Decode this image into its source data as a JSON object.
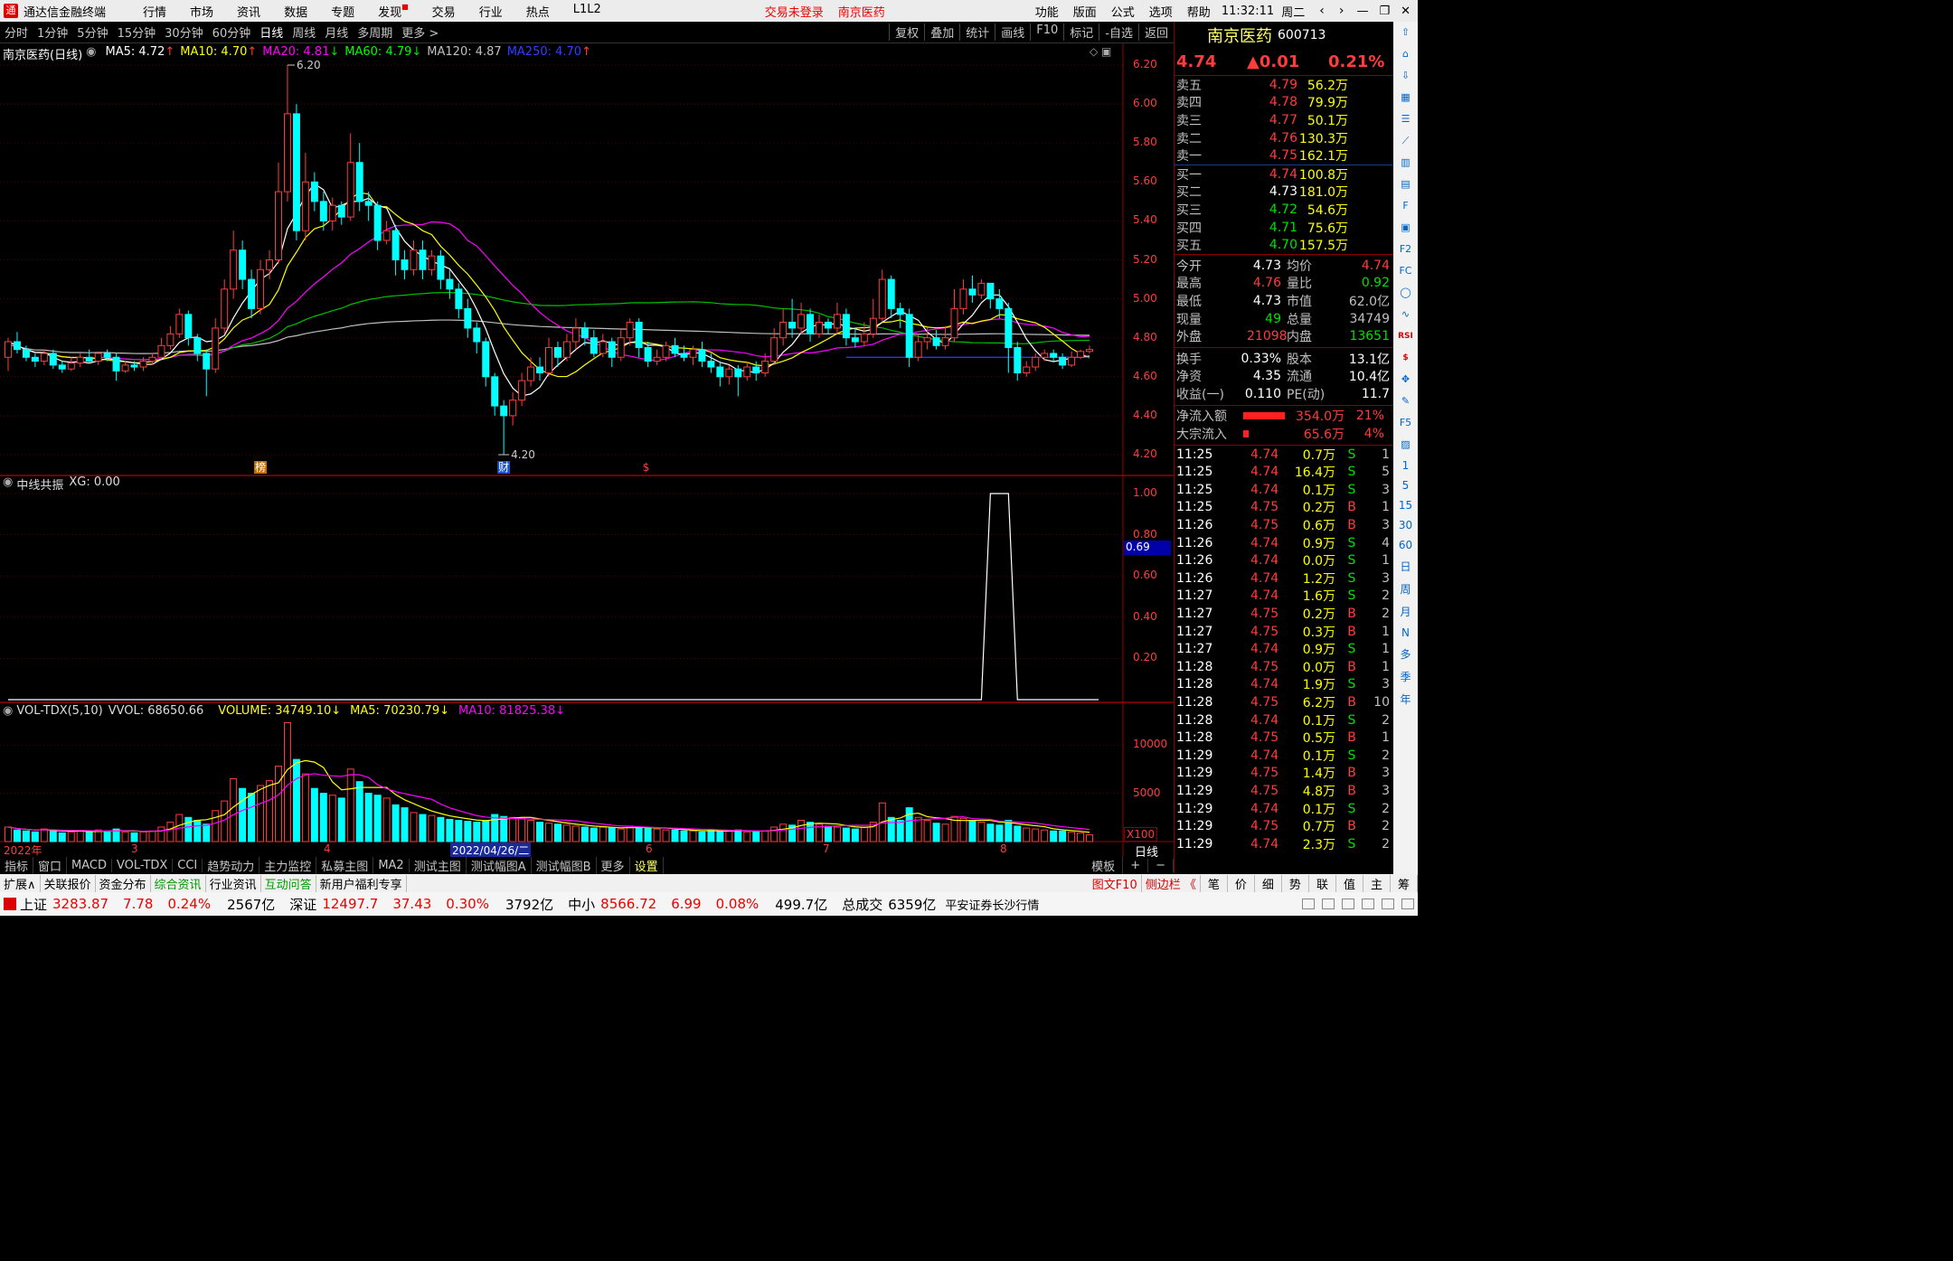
{
  "app": {
    "title": "通达信金融终端",
    "time": "11:32:11",
    "weekday": "周二"
  },
  "menu": [
    "行情",
    "市场",
    "资讯",
    "数据",
    "专题",
    "发现",
    "交易",
    "行业",
    "热点",
    "L1L2"
  ],
  "menu_right": [
    "功能",
    "版面",
    "公式",
    "选项",
    "帮助"
  ],
  "login_status": "交易未登录",
  "top_stock": "南京医药",
  "toolbar": {
    "periods": [
      "分时",
      "1分钟",
      "5分钟",
      "15分钟",
      "30分钟",
      "60分钟",
      "日线",
      "周线",
      "月线",
      "多周期",
      "更多 >"
    ],
    "active": "日线",
    "right": [
      "复权",
      "叠加",
      "统计",
      "画线",
      "F10",
      "标记",
      "-自选",
      "返回"
    ]
  },
  "chart": {
    "title": "南京医药(日线)",
    "ma_legend": [
      {
        "label": "MA5: 4.72",
        "arrow": "↑",
        "color": "#ffffff"
      },
      {
        "label": "MA10: 4.70",
        "arrow": "↑",
        "color": "#ffff00"
      },
      {
        "label": "MA20: 4.81",
        "arrow": "↓",
        "color": "#ff00ff"
      },
      {
        "label": "MA60: 4.79",
        "arrow": "↓",
        "color": "#00ff00"
      },
      {
        "label": "MA120: 4.87",
        "arrow": "",
        "color": "#c0c0c0"
      },
      {
        "label": "MA250: 4.70",
        "arrow": "↑",
        "color": "#3040ff"
      }
    ],
    "price_axis": [
      "6.20",
      "6.00",
      "5.80",
      "5.60",
      "5.40",
      "5.20",
      "5.00",
      "4.80",
      "4.60",
      "4.40",
      "4.20"
    ],
    "high_label": "6.20",
    "low_label": "4.20",
    "markers": [
      "榜",
      "财",
      "$"
    ]
  },
  "indicator": {
    "title": "中线共振",
    "xg": "XG: 0.00",
    "axis": [
      "1.00",
      "0.80",
      "0.60",
      "0.40",
      "0.20"
    ],
    "current": "0.69"
  },
  "volume": {
    "title": "VOL-TDX(5,10)",
    "vvol": "VVOL: 68650.66",
    "vol": "VOLUME: 34749.10",
    "ma5": "MA5: 70230.79",
    "ma10": "MA10: 81825.38",
    "axis": [
      "10000",
      "5000"
    ],
    "unit": "X100"
  },
  "date_axis": {
    "labels": [
      "2022年",
      "3",
      "4",
      "2022/04/26/二",
      "6",
      "7",
      "8"
    ],
    "period": "日线"
  },
  "quote": {
    "name": "南京医药",
    "code": "600713",
    "price": "4.74",
    "change": "▲0.01",
    "pct": "0.21%",
    "asks": [
      {
        "l": "卖五",
        "p": "4.79",
        "v": "56.2万"
      },
      {
        "l": "卖四",
        "p": "4.78",
        "v": "79.9万"
      },
      {
        "l": "卖三",
        "p": "4.77",
        "v": "50.1万"
      },
      {
        "l": "卖二",
        "p": "4.76",
        "v": "130.3万"
      },
      {
        "l": "卖一",
        "p": "4.75",
        "v": "162.1万"
      }
    ],
    "bids": [
      {
        "l": "买一",
        "p": "4.74",
        "v": "100.8万",
        "c": "red"
      },
      {
        "l": "买二",
        "p": "4.73",
        "v": "181.0万",
        "c": "wht"
      },
      {
        "l": "买三",
        "p": "4.72",
        "v": "54.6万",
        "c": "grn"
      },
      {
        "l": "买四",
        "p": "4.71",
        "v": "75.6万",
        "c": "grn"
      },
      {
        "l": "买五",
        "p": "4.70",
        "v": "157.5万",
        "c": "grn"
      }
    ],
    "stats": [
      {
        "l1": "今开",
        "v1": "4.73",
        "c1": "wht",
        "l2": "均价",
        "v2": "4.74",
        "c2": "red"
      },
      {
        "l1": "最高",
        "v1": "4.76",
        "c1": "red",
        "l2": "量比",
        "v2": "0.92",
        "c2": "grn"
      },
      {
        "l1": "最低",
        "v1": "4.73",
        "c1": "wht",
        "l2": "市值",
        "v2": "62.0亿",
        "c2": "gray"
      },
      {
        "l1": "现量",
        "v1": "49",
        "c1": "grn",
        "l2": "总量",
        "v2": "34749",
        "c2": "gray"
      },
      {
        "l1": "外盘",
        "v1": "21098",
        "c1": "red",
        "l2": "内盘",
        "v2": "13651",
        "c2": "grn"
      }
    ],
    "stats2": [
      {
        "l1": "换手",
        "v1": "0.33%",
        "l2": "股本",
        "v2": "13.1亿"
      },
      {
        "l1": "净资",
        "v1": "4.35",
        "l2": "流通",
        "v2": "10.4亿"
      },
      {
        "l1": "收益(一)",
        "v1": "0.110",
        "l2": "PE(动)",
        "v2": "11.7"
      }
    ],
    "flows": [
      {
        "l": "净流入额",
        "v": "354.0万",
        "p": "21%",
        "bar": 0.8
      },
      {
        "l": "大宗流入",
        "v": "65.6万",
        "p": "4%",
        "bar": 0.1
      }
    ],
    "ticks": [
      [
        "11:25",
        "4.74",
        "0.7万",
        "S",
        "1"
      ],
      [
        "11:25",
        "4.74",
        "16.4万",
        "S",
        "5"
      ],
      [
        "11:25",
        "4.74",
        "0.1万",
        "S",
        "3"
      ],
      [
        "11:25",
        "4.75",
        "0.2万",
        "B",
        "1"
      ],
      [
        "11:26",
        "4.75",
        "0.6万",
        "B",
        "3"
      ],
      [
        "11:26",
        "4.74",
        "0.9万",
        "S",
        "4"
      ],
      [
        "11:26",
        "4.74",
        "0.0万",
        "S",
        "1"
      ],
      [
        "11:26",
        "4.74",
        "1.2万",
        "S",
        "3"
      ],
      [
        "11:27",
        "4.74",
        "1.6万",
        "S",
        "2"
      ],
      [
        "11:27",
        "4.75",
        "0.2万",
        "B",
        "2"
      ],
      [
        "11:27",
        "4.75",
        "0.3万",
        "B",
        "1"
      ],
      [
        "11:27",
        "4.74",
        "0.9万",
        "S",
        "1"
      ],
      [
        "11:28",
        "4.75",
        "0.0万",
        "B",
        "1"
      ],
      [
        "11:28",
        "4.74",
        "1.9万",
        "S",
        "3"
      ],
      [
        "11:28",
        "4.75",
        "6.2万",
        "B",
        "10"
      ],
      [
        "11:28",
        "4.74",
        "0.1万",
        "S",
        "2"
      ],
      [
        "11:28",
        "4.75",
        "0.5万",
        "B",
        "1"
      ],
      [
        "11:29",
        "4.74",
        "0.1万",
        "S",
        "2"
      ],
      [
        "11:29",
        "4.75",
        "1.4万",
        "B",
        "3"
      ],
      [
        "11:29",
        "4.75",
        "4.8万",
        "B",
        "3"
      ],
      [
        "11:29",
        "4.74",
        "0.1万",
        "S",
        "2"
      ],
      [
        "11:29",
        "4.75",
        "0.7万",
        "B",
        "2"
      ],
      [
        "11:29",
        "4.74",
        "2.3万",
        "S",
        "2"
      ]
    ]
  },
  "sidebar_icons": [
    "up-icon",
    "home-icon",
    "down-icon",
    "chart-icon",
    "list-icon",
    "trend-icon",
    "candle-icon",
    "doc-icon",
    "f10-icon",
    "book-icon",
    "f2-icon",
    "fc-icon",
    "circle-icon",
    "line-icon",
    "rsi",
    "dollar-icon",
    "move-icon",
    "pen-icon",
    "f5-icon",
    "sheet-icon"
  ],
  "sidebar_periods": [
    "1",
    "5",
    "15",
    "30",
    "60",
    "日",
    "周",
    "月",
    "N",
    "多",
    "季",
    "年"
  ],
  "tabs": [
    "指标",
    "窗口",
    "MACD",
    "VOL-TDX",
    "CCI",
    "趋势动力",
    "主力监控",
    "私募主图",
    "MA2",
    "测试主图",
    "测试幅图A",
    "测试幅图B",
    "更多",
    "设置"
  ],
  "tabs_right": [
    "模板",
    "+",
    "−"
  ],
  "bottom_tabs": [
    "扩展∧",
    "关联报价",
    "资金分布",
    "综合资讯",
    "行业资讯",
    "互动问答",
    "新用户福利专享"
  ],
  "bottom_right": [
    "图文F10",
    "侧边栏 《",
    "笔",
    "价",
    "细",
    "势",
    "联",
    "值",
    "主",
    "筹"
  ],
  "status": {
    "indices": [
      {
        "n": "上证",
        "v": "3283.87",
        "c": "7.78",
        "p": "0.24%",
        "a": "2567亿"
      },
      {
        "n": "深证",
        "v": "12497.7",
        "c": "37.43",
        "p": "0.30%",
        "a": "3792亿"
      },
      {
        "n": "中小",
        "v": "8566.72",
        "c": "6.99",
        "p": "0.08%",
        "a": "499.7亿"
      }
    ],
    "total_label": "总成交",
    "total": "6359亿",
    "broker": "平安证券长沙行情"
  },
  "chart_data": {
    "type": "candlestick",
    "ylim": [
      4.2,
      6.2
    ],
    "candles": [
      [
        4.7,
        4.78,
        4.63,
        4.8
      ],
      [
        4.78,
        4.74,
        4.72,
        4.83
      ],
      [
        4.74,
        4.7,
        4.68,
        4.76
      ],
      [
        4.7,
        4.68,
        4.65,
        4.72
      ],
      [
        4.68,
        4.72,
        4.66,
        4.74
      ],
      [
        4.72,
        4.66,
        4.64,
        4.74
      ],
      [
        4.66,
        4.64,
        4.62,
        4.68
      ],
      [
        4.64,
        4.67,
        4.63,
        4.7
      ],
      [
        4.67,
        4.7,
        4.65,
        4.72
      ],
      [
        4.7,
        4.68,
        4.67,
        4.74
      ],
      [
        4.68,
        4.72,
        4.66,
        4.73
      ],
      [
        4.72,
        4.7,
        4.68,
        4.74
      ],
      [
        4.7,
        4.63,
        4.58,
        4.72
      ],
      [
        4.63,
        4.66,
        4.62,
        4.68
      ],
      [
        4.66,
        4.65,
        4.63,
        4.68
      ],
      [
        4.65,
        4.68,
        4.63,
        4.7
      ],
      [
        4.68,
        4.7,
        4.66,
        4.72
      ],
      [
        4.7,
        4.76,
        4.69,
        4.8
      ],
      [
        4.76,
        4.82,
        4.74,
        4.86
      ],
      [
        4.82,
        4.92,
        4.8,
        4.95
      ],
      [
        4.92,
        4.8,
        4.76,
        4.94
      ],
      [
        4.8,
        4.72,
        4.68,
        4.82
      ],
      [
        4.72,
        4.64,
        4.5,
        4.74
      ],
      [
        4.64,
        4.85,
        4.62,
        4.9
      ],
      [
        4.85,
        5.05,
        4.82,
        5.1
      ],
      [
        5.05,
        5.25,
        5.0,
        5.35
      ],
      [
        5.25,
        5.1,
        5.05,
        5.3
      ],
      [
        5.1,
        4.95,
        4.9,
        5.15
      ],
      [
        4.95,
        5.15,
        4.92,
        5.2
      ],
      [
        5.15,
        5.2,
        5.1,
        5.25
      ],
      [
        5.2,
        5.55,
        5.18,
        5.7
      ],
      [
        5.55,
        5.95,
        5.5,
        6.2
      ],
      [
        5.95,
        5.35,
        5.3,
        6.0
      ],
      [
        5.35,
        5.6,
        5.3,
        5.75
      ],
      [
        5.6,
        5.5,
        5.45,
        5.65
      ],
      [
        5.5,
        5.4,
        5.35,
        5.55
      ],
      [
        5.4,
        5.48,
        5.35,
        5.52
      ],
      [
        5.48,
        5.42,
        5.38,
        5.5
      ],
      [
        5.42,
        5.7,
        5.4,
        5.85
      ],
      [
        5.7,
        5.5,
        5.45,
        5.8
      ],
      [
        5.5,
        5.48,
        5.4,
        5.55
      ],
      [
        5.48,
        5.3,
        5.25,
        5.5
      ],
      [
        5.3,
        5.35,
        5.28,
        5.4
      ],
      [
        5.35,
        5.2,
        5.12,
        5.38
      ],
      [
        5.2,
        5.15,
        5.1,
        5.25
      ],
      [
        5.15,
        5.25,
        5.12,
        5.3
      ],
      [
        5.25,
        5.15,
        5.1,
        5.3
      ],
      [
        5.15,
        5.22,
        5.12,
        5.25
      ],
      [
        5.22,
        5.1,
        5.05,
        5.25
      ],
      [
        5.1,
        5.05,
        5.0,
        5.15
      ],
      [
        5.05,
        4.95,
        4.9,
        5.08
      ],
      [
        4.95,
        4.85,
        4.8,
        5.0
      ],
      [
        4.85,
        4.78,
        4.72,
        4.88
      ],
      [
        4.78,
        4.6,
        4.55,
        4.8
      ],
      [
        4.6,
        4.45,
        4.4,
        4.62
      ],
      [
        4.45,
        4.4,
        4.2,
        4.48
      ],
      [
        4.4,
        4.48,
        4.35,
        4.52
      ],
      [
        4.48,
        4.58,
        4.45,
        4.62
      ],
      [
        4.58,
        4.65,
        4.55,
        4.7
      ],
      [
        4.65,
        4.62,
        4.58,
        4.7
      ],
      [
        4.62,
        4.75,
        4.6,
        4.8
      ],
      [
        4.75,
        4.7,
        4.65,
        4.78
      ],
      [
        4.7,
        4.78,
        4.68,
        4.82
      ],
      [
        4.78,
        4.85,
        4.74,
        4.9
      ],
      [
        4.85,
        4.8,
        4.76,
        4.88
      ],
      [
        4.8,
        4.72,
        4.7,
        4.84
      ],
      [
        4.72,
        4.78,
        4.7,
        4.82
      ],
      [
        4.78,
        4.7,
        4.65,
        4.8
      ],
      [
        4.7,
        4.8,
        4.68,
        4.85
      ],
      [
        4.8,
        4.88,
        4.76,
        4.9
      ],
      [
        4.88,
        4.75,
        4.7,
        4.9
      ],
      [
        4.75,
        4.68,
        4.65,
        4.78
      ],
      [
        4.68,
        4.7,
        4.66,
        4.74
      ],
      [
        4.7,
        4.76,
        4.68,
        4.78
      ],
      [
        4.76,
        4.72,
        4.7,
        4.8
      ],
      [
        4.72,
        4.7,
        4.68,
        4.76
      ],
      [
        4.7,
        4.74,
        4.66,
        4.76
      ],
      [
        4.74,
        4.68,
        4.65,
        4.78
      ],
      [
        4.68,
        4.65,
        4.62,
        4.72
      ],
      [
        4.65,
        4.6,
        4.55,
        4.68
      ],
      [
        4.6,
        4.64,
        4.56,
        4.66
      ],
      [
        4.64,
        4.6,
        4.5,
        4.66
      ],
      [
        4.6,
        4.65,
        4.58,
        4.68
      ],
      [
        4.65,
        4.62,
        4.58,
        4.68
      ],
      [
        4.62,
        4.68,
        4.6,
        4.72
      ],
      [
        4.68,
        4.8,
        4.66,
        4.85
      ],
      [
        4.8,
        4.88,
        4.76,
        4.95
      ],
      [
        4.88,
        4.85,
        4.8,
        5.0
      ],
      [
        4.85,
        4.92,
        4.82,
        4.98
      ],
      [
        4.92,
        4.82,
        4.78,
        4.95
      ],
      [
        4.82,
        4.88,
        4.8,
        4.92
      ],
      [
        4.88,
        4.85,
        4.82,
        4.9
      ],
      [
        4.85,
        4.92,
        4.82,
        4.98
      ],
      [
        4.92,
        4.8,
        4.76,
        4.95
      ],
      [
        4.8,
        4.78,
        4.75,
        4.85
      ],
      [
        4.78,
        4.82,
        4.76,
        4.88
      ],
      [
        4.82,
        4.9,
        4.8,
        5.0
      ],
      [
        4.9,
        5.1,
        4.88,
        5.15
      ],
      [
        5.1,
        4.95,
        4.9,
        5.12
      ],
      [
        4.95,
        4.92,
        4.85,
        4.98
      ],
      [
        4.92,
        4.7,
        4.65,
        4.95
      ],
      [
        4.7,
        4.78,
        4.68,
        4.82
      ],
      [
        4.78,
        4.8,
        4.74,
        4.85
      ],
      [
        4.8,
        4.76,
        4.74,
        4.84
      ],
      [
        4.76,
        4.8,
        4.74,
        4.86
      ],
      [
        4.8,
        4.95,
        4.78,
        5.05
      ],
      [
        4.95,
        5.05,
        4.92,
        5.1
      ],
      [
        5.05,
        5.02,
        4.98,
        5.12
      ],
      [
        5.02,
        5.08,
        5.0,
        5.1
      ],
      [
        5.08,
        5.0,
        4.95,
        5.08
      ],
      [
        5.0,
        4.95,
        4.9,
        5.05
      ],
      [
        4.95,
        4.75,
        4.62,
        4.98
      ],
      [
        4.75,
        4.62,
        4.58,
        4.78
      ],
      [
        4.62,
        4.65,
        4.6,
        4.68
      ],
      [
        4.65,
        4.7,
        4.63,
        4.72
      ],
      [
        4.7,
        4.72,
        4.68,
        4.74
      ],
      [
        4.72,
        4.7,
        4.68,
        4.74
      ],
      [
        4.7,
        4.66,
        4.64,
        4.72
      ],
      [
        4.66,
        4.7,
        4.65,
        4.73
      ],
      [
        4.7,
        4.73,
        4.69,
        4.74
      ],
      [
        4.73,
        4.74,
        4.72,
        4.76
      ]
    ],
    "volumes": [
      1500,
      1200,
      1100,
      1000,
      1300,
      1200,
      900,
      1000,
      1100,
      1000,
      1200,
      1100,
      1300,
      1000,
      900,
      1000,
      1100,
      1500,
      2000,
      2800,
      2500,
      2200,
      1800,
      3200,
      4200,
      6500,
      5500,
      5000,
      5800,
      6300,
      7800,
      12300,
      8500,
      7000,
      5500,
      5000,
      4800,
      4500,
      7500,
      6200,
      5000,
      4800,
      4500,
      3800,
      3500,
      3000,
      2800,
      2700,
      2500,
      2300,
      2200,
      2100,
      2000,
      2200,
      2800,
      2600,
      2500,
      2400,
      2200,
      2000,
      1900,
      1800,
      1700,
      1600,
      1500,
      1400,
      1500,
      1400,
      1300,
      1600,
      1500,
      1400,
      1300,
      1200,
      1200,
      1100,
      1100,
      1000,
      1200,
      1100,
      1100,
      1200,
      1000,
      1000,
      1100,
      1500,
      1800,
      1700,
      2200,
      2000,
      1800,
      1600,
      1500,
      1400,
      1300,
      1500,
      2000,
      4000,
      2500,
      2200,
      3500,
      2500,
      2200,
      1900,
      1800,
      2600,
      2400,
      2200,
      2000,
      1800,
      1700,
      2200,
      1600,
      1400,
      1300,
      1200,
      1100,
      1100,
      1000,
      900,
      700
    ],
    "indicator_xg": [
      0,
      0,
      0,
      0,
      0,
      0,
      0,
      0,
      0,
      0,
      0,
      0,
      0,
      0,
      0,
      0,
      0,
      0,
      0,
      0,
      0,
      0,
      0,
      0,
      0,
      0,
      0,
      0,
      0,
      0,
      0,
      0,
      0,
      0,
      0,
      0,
      0,
      0,
      0,
      0,
      0,
      0,
      0,
      0,
      0,
      0,
      0,
      0,
      0,
      0,
      0,
      0,
      0,
      0,
      0,
      0,
      0,
      0,
      0,
      0,
      0,
      0,
      0,
      0,
      0,
      0,
      0,
      0,
      0,
      0,
      0,
      0,
      0,
      0,
      0,
      0,
      0,
      0,
      0,
      0,
      0,
      0,
      0,
      0,
      0,
      0,
      0,
      0,
      0,
      0,
      0,
      0,
      0,
      0,
      0,
      0,
      0,
      0,
      0,
      0,
      0,
      0,
      0,
      0,
      0,
      0,
      0,
      0,
      0,
      1,
      1,
      1,
      0,
      0,
      0,
      0,
      0,
      0,
      0,
      0,
      0,
      0
    ]
  }
}
